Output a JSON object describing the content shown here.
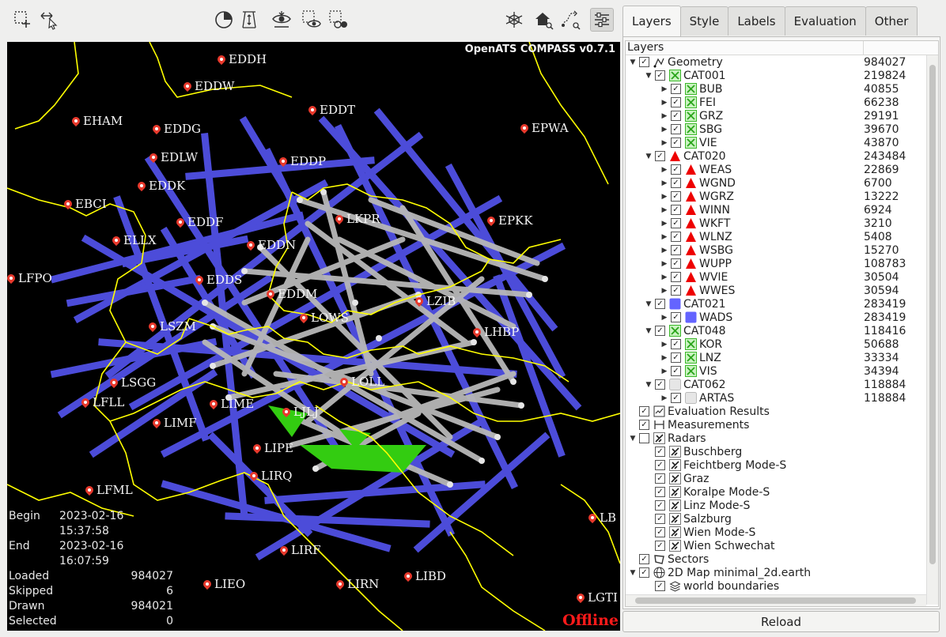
{
  "toolbar": {
    "left_tools": [
      "select-rectangle-icon",
      "select-move-icon"
    ],
    "center_tools": [
      "time-window-icon",
      "height-filter-icon",
      "eye-icon",
      "select-eye-icon",
      "select-eye-dots-icon"
    ],
    "right_tools": [
      "axes-3d-icon",
      "home-zoom-icon",
      "route-zoom-icon",
      "settings-sliders-icon"
    ]
  },
  "map": {
    "app_title": "OpenATS COMPASS v0.7.1",
    "offline_label": "Offline",
    "colors": {
      "background": "#000000",
      "boundaries": "#ffff00",
      "tracks_blue": "#5a5aff",
      "tracks_gray": "#b8b8b8",
      "tracks_green": "#33cc11",
      "pin": "#e8392c"
    },
    "airports": [
      "EDDH",
      "EDDW",
      "EDDT",
      "EHAM",
      "EDDG",
      "EPWA",
      "EDLW",
      "EDDP",
      "EDDK",
      "EBCI",
      "EDDF",
      "LKPR",
      "EPKK",
      "ELLX",
      "EDDN",
      "LFPO",
      "EDDS",
      "EDDM",
      "LZIB",
      "LOWS",
      "LSZM",
      "LHBP",
      "LOLL",
      "LSGG",
      "LFLL",
      "LIME",
      "LIMF",
      "LJLJ",
      "LIPE",
      "LIRQ",
      "LFML",
      "LB",
      "LIRF",
      "LIBD",
      "LIEO",
      "LIRN",
      "LGTI"
    ],
    "stats": {
      "begin_label": "Begin",
      "begin_value": "2023-02-16 15:37:58",
      "end_label": "End",
      "end_value": "2023-02-16 16:07:59",
      "loaded_label": "Loaded",
      "loaded_value": "984027",
      "skipped_label": "Skipped",
      "skipped_value": "6",
      "drawn_label": "Drawn",
      "drawn_value": "984021",
      "selected_label": "Selected",
      "selected_value": "0"
    }
  },
  "panel": {
    "tabs": [
      "Layers",
      "Style",
      "Labels",
      "Evaluation",
      "Other"
    ],
    "active_tab": "Layers",
    "tree_header": "Layers",
    "tree": [
      {
        "name": "Geometry",
        "count": "984027",
        "icon": "geometry-icon",
        "checked": true
      },
      {
        "name": "CAT001",
        "count": "219824",
        "icon": "green-cross-icon",
        "checked": true
      },
      {
        "name": "BUB",
        "count": "40855",
        "icon": "green-cross-icon",
        "checked": true
      },
      {
        "name": "FEI",
        "count": "66238",
        "icon": "green-cross-icon",
        "checked": true
      },
      {
        "name": "GRZ",
        "count": "29191",
        "icon": "green-cross-icon",
        "checked": true
      },
      {
        "name": "SBG",
        "count": "39670",
        "icon": "green-cross-icon",
        "checked": true
      },
      {
        "name": "VIE",
        "count": "43870",
        "icon": "green-cross-icon",
        "checked": true
      },
      {
        "name": "CAT020",
        "count": "243484",
        "icon": "red-triangle-icon",
        "checked": true
      },
      {
        "name": "WEAS",
        "count": "22869",
        "icon": "red-triangle-icon",
        "checked": true
      },
      {
        "name": "WGND",
        "count": "6700",
        "icon": "red-triangle-icon",
        "checked": true
      },
      {
        "name": "WGRZ",
        "count": "13222",
        "icon": "red-triangle-icon",
        "checked": true
      },
      {
        "name": "WINN",
        "count": "6924",
        "icon": "red-triangle-icon",
        "checked": true
      },
      {
        "name": "WKFT",
        "count": "3210",
        "icon": "red-triangle-icon",
        "checked": true
      },
      {
        "name": "WLNZ",
        "count": "5408",
        "icon": "red-triangle-icon",
        "checked": true
      },
      {
        "name": "WSBG",
        "count": "15270",
        "icon": "red-triangle-icon",
        "checked": true
      },
      {
        "name": "WUPP",
        "count": "108783",
        "icon": "red-triangle-icon",
        "checked": true
      },
      {
        "name": "WVIE",
        "count": "30504",
        "icon": "red-triangle-icon",
        "checked": true
      },
      {
        "name": "WWES",
        "count": "30594",
        "icon": "red-triangle-icon",
        "checked": true
      },
      {
        "name": "CAT021",
        "count": "283419",
        "icon": "blue-square-icon",
        "checked": true
      },
      {
        "name": "WADS",
        "count": "283419",
        "icon": "blue-square-icon",
        "checked": true
      },
      {
        "name": "CAT048",
        "count": "118416",
        "icon": "green-cross-icon",
        "checked": true
      },
      {
        "name": "KOR",
        "count": "50688",
        "icon": "green-cross-icon",
        "checked": true
      },
      {
        "name": "LNZ",
        "count": "33334",
        "icon": "green-cross-icon",
        "checked": true
      },
      {
        "name": "VIS",
        "count": "34394",
        "icon": "green-cross-icon",
        "checked": true
      },
      {
        "name": "CAT062",
        "count": "118884",
        "icon": "gray-square-icon",
        "checked": true
      },
      {
        "name": "ARTAS",
        "count": "118884",
        "icon": "gray-square-icon",
        "checked": true
      },
      {
        "name": "Evaluation Results",
        "count": "",
        "icon": "eval-results-icon",
        "checked": true
      },
      {
        "name": "Measurements",
        "count": "",
        "icon": "measurement-icon",
        "checked": true
      },
      {
        "name": "Radars",
        "count": "",
        "icon": "radar-icon",
        "checked": false
      },
      {
        "name": "Buschberg",
        "count": "",
        "icon": "radar-icon",
        "checked": true
      },
      {
        "name": "Feichtberg Mode-S",
        "count": "",
        "icon": "radar-icon",
        "checked": true
      },
      {
        "name": "Graz",
        "count": "",
        "icon": "radar-icon",
        "checked": true
      },
      {
        "name": "Koralpe Mode-S",
        "count": "",
        "icon": "radar-icon",
        "checked": true
      },
      {
        "name": "Linz Mode-S",
        "count": "",
        "icon": "radar-icon",
        "checked": true
      },
      {
        "name": "Salzburg",
        "count": "",
        "icon": "radar-icon",
        "checked": true
      },
      {
        "name": "Wien Mode-S",
        "count": "",
        "icon": "radar-icon",
        "checked": true
      },
      {
        "name": "Wien Schwechat",
        "count": "",
        "icon": "radar-icon",
        "checked": true
      },
      {
        "name": "Sectors",
        "count": "",
        "icon": "sector-icon",
        "checked": true
      },
      {
        "name": "2D Map minimal_2d.earth",
        "count": "",
        "icon": "globe-icon",
        "checked": true
      },
      {
        "name": "world boundaries",
        "count": "",
        "icon": "layers-icon",
        "checked": true
      }
    ],
    "reload_label": "Reload"
  }
}
